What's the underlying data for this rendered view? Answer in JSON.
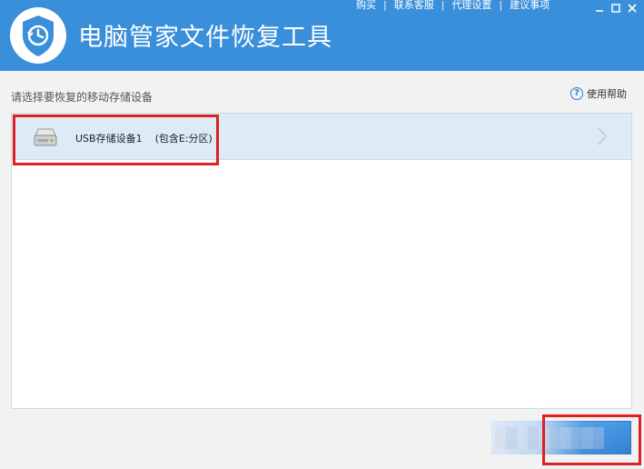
{
  "window": {
    "title": "电脑管家文件恢复工具",
    "menu": [
      "购买",
      "联系客服",
      "代理设置",
      "建议事项"
    ]
  },
  "content": {
    "prompt": "请选择要恢复的移动存储设备",
    "help_label": "使用帮助",
    "help_icon": "question-circle-icon"
  },
  "devices": [
    {
      "name": "USB存储设备1",
      "partition": "(包含E:分区)",
      "icon": "usb-drive-icon"
    }
  ],
  "footer": {
    "primary_button_label": ""
  },
  "colors": {
    "header": "#3a8fdb",
    "row_selected": "#ddebf7",
    "highlight": "#e02020",
    "button": "#2a7fd0"
  }
}
